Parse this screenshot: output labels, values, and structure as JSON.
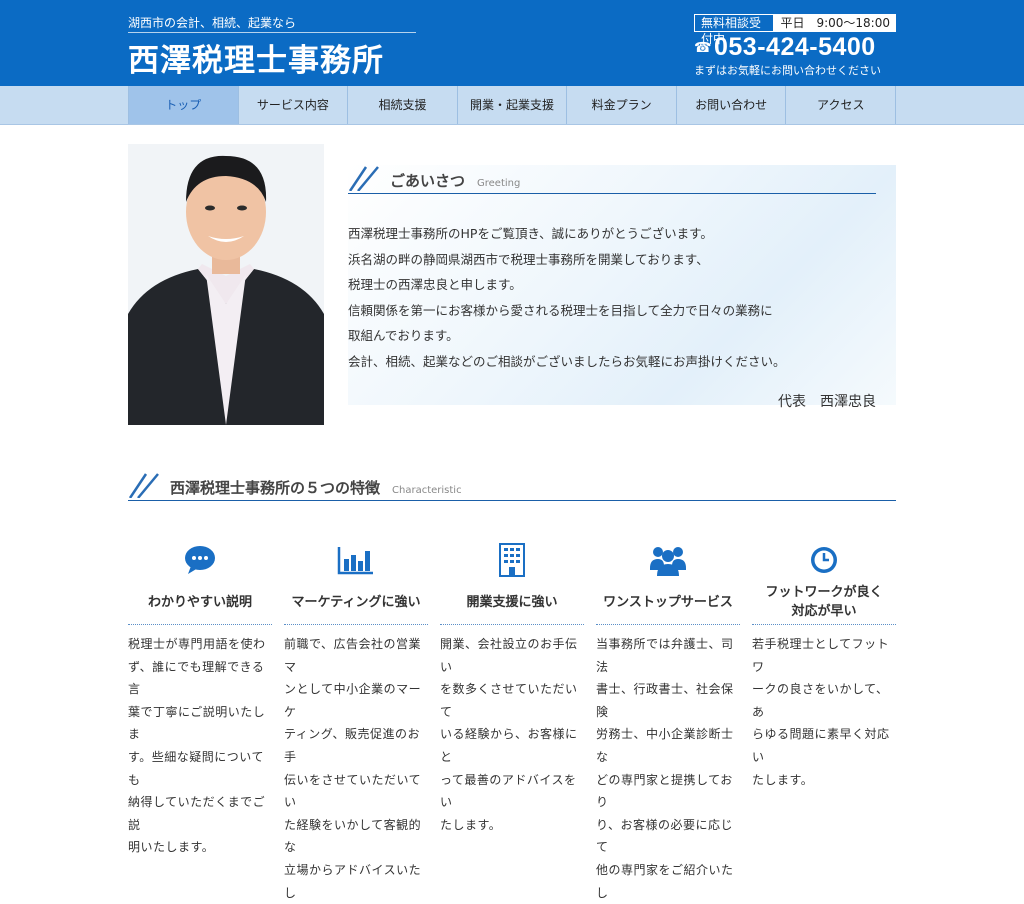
{
  "header": {
    "tagline": "湖西市の会計、相続、起業なら",
    "site_title": "西澤税理士事務所",
    "consult_label": "無料相談受付中",
    "hours": "平日　9:00～18:00",
    "phone": "053-424-5400",
    "phone_icon": "☎",
    "phone_note": "まずはお気軽にお問い合わせください"
  },
  "nav": {
    "items": [
      {
        "label": "トップ"
      },
      {
        "label": "サービス内容"
      },
      {
        "label": "相続支援"
      },
      {
        "label": "開業・起業支援"
      },
      {
        "label": "料金プラン"
      },
      {
        "label": "お問い合わせ"
      },
      {
        "label": "アクセス"
      }
    ]
  },
  "greeting": {
    "title": "ごあいさつ",
    "subtitle": "Greeting",
    "lines": [
      "西澤税理士事務所のHPをご覧頂き、誠にありがとうございます。",
      "浜名湖の畔の静岡県湖西市で税理士事務所を開業しております、",
      "税理士の西澤忠良と申します。",
      "信頼関係を第一にお客様から愛される税理士を目指して全力で日々の業務に",
      "取組んでおります。",
      "会計、相続、起業などのご相談がございましたらお気軽にお声掛けください。"
    ],
    "signature": "代表　西澤忠良"
  },
  "features_section": {
    "title": "西澤税理士事務所の５つの特徴",
    "subtitle": "Characteristic",
    "items": [
      {
        "icon": "speech-bubble-icon",
        "title": "わかりやすい説明",
        "body": [
          "税理士が専門用語を使わ",
          "ず、誰にでも理解できる言",
          "葉で丁寧にご説明いたしま",
          "す。些細な疑問についても",
          "納得していただくまでご説",
          "明いたします。"
        ]
      },
      {
        "icon": "bar-chart-icon",
        "title": "マーケティングに強い",
        "body": [
          "前職で、広告会社の営業マ",
          "ンとして中小企業のマーケ",
          "ティング、販売促進のお手",
          "伝いをさせていただいてい",
          "た経験をいかして客観的な",
          "立場からアドバイスいたし"
        ]
      },
      {
        "icon": "building-icon",
        "title": "開業支援に強い",
        "body": [
          "開業、会社設立のお手伝い",
          "を数多くさせていただいて",
          "いる経験から、お客様にと",
          "って最善のアドバイスをい",
          "たします。"
        ]
      },
      {
        "icon": "group-icon",
        "title": "ワンストップサービス",
        "body": [
          "当事務所では弁護士、司法",
          "書士、行政書士、社会保険",
          "労務士、中小企業診断士な",
          "どの専門家と提携しており",
          "り、お客様の必要に応じて",
          "他の専門家をご紹介いたし"
        ]
      },
      {
        "icon": "clock-icon",
        "title_lines": [
          "フットワークが良く",
          "対応が早い"
        ],
        "body": [
          "若手税理士としてフットワ",
          "ークの良さをいかして、あ",
          "らゆる問題に素早く対応い",
          "たします。"
        ]
      }
    ]
  },
  "colors": {
    "brand_blue": "#0b6bc4",
    "nav_bg": "#c6dcf1",
    "nav_active": "#9fc3ea",
    "icon_blue": "#1a6fc4"
  }
}
